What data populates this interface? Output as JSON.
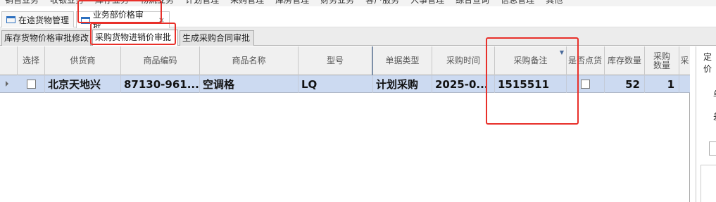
{
  "menu": {
    "items": [
      "销售业务",
      "收银业务",
      "库存业务",
      "物流业务",
      "计划管理",
      "采购管理",
      "库房管理",
      "财务业务",
      "客户服务",
      "人事管理",
      "综合查询",
      "信息管理",
      "其他"
    ]
  },
  "doc_tabs": [
    {
      "label": "在途货物管理"
    },
    {
      "label": "业务部价格审批",
      "close": "×"
    }
  ],
  "sub_tabs": [
    {
      "label": "库存货物价格审批修改"
    },
    {
      "label": "采购货物进销价审批"
    },
    {
      "label": "生成采购合同审批"
    }
  ],
  "grid": {
    "columns": [
      "选择",
      "供货商",
      "商品编码",
      "商品名称",
      "型号",
      "单据类型",
      "采购时间",
      "采购备注",
      "是否点货",
      "库存数量",
      "采购数量",
      "采"
    ],
    "rows": [
      {
        "selected": false,
        "supplier": "北京天地兴",
        "product_code": "87130-961...",
        "product_name": "空调格",
        "model": "LQ",
        "doc_type": "计划采购",
        "purchase_time": "2025-0...",
        "purchase_note": "1515511",
        "counted": false,
        "stock_qty": "52",
        "purchase_qty": "1"
      }
    ]
  },
  "right_panel": {
    "label_top": "定价",
    "label_mid1": "单",
    "label_mid2": "差"
  },
  "colors": {
    "row_selected": "#ccdaf1",
    "annotation_red": "#e8302a",
    "icon_blue": "#2c6fbf"
  }
}
